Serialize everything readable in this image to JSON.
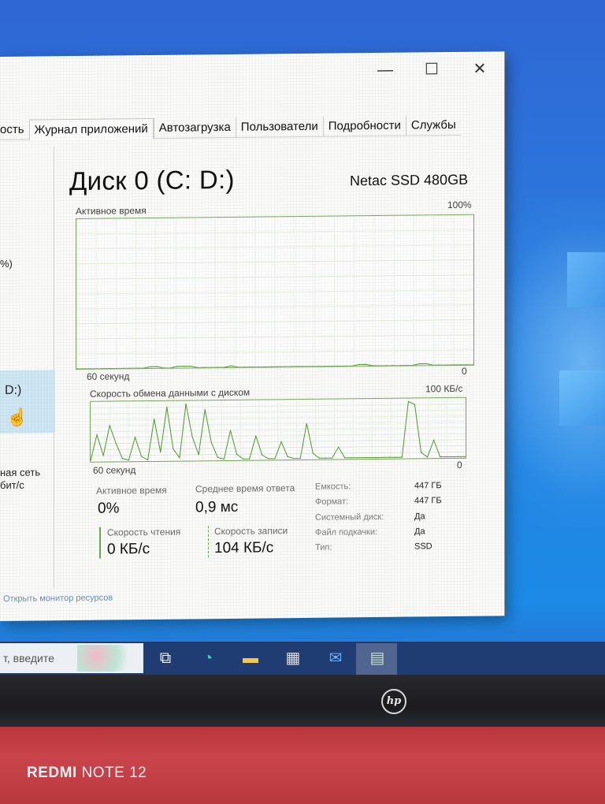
{
  "window": {
    "minimize_glyph": "—",
    "maximize_glyph": "☐",
    "close_glyph": "✕"
  },
  "tabs": [
    "ость",
    "Журнал приложений",
    "Автозагрузка",
    "Пользователи",
    "Подробности",
    "Службы"
  ],
  "sidebar": {
    "item_pct": "%)",
    "item_disk": "D:)",
    "item_net_1": "ная сеть",
    "item_net_2": "бит/с"
  },
  "disk": {
    "title": "Диск 0 (C: D:)",
    "model": "Netac SSD 480GB"
  },
  "graph_active": {
    "label": "Активное время",
    "max_label": "100%",
    "time_label": "60 секунд",
    "min_label": "0"
  },
  "graph_transfer": {
    "label": "Скорость обмена данными с диском",
    "max_label": "100 КБ/с",
    "time_label": "60 секунд",
    "min_label": "0"
  },
  "chart_data": [
    {
      "type": "area",
      "title": "Активное время",
      "xlabel": "60 секунд",
      "ylim": [
        0,
        100
      ],
      "series": [
        {
          "values": [
            0,
            0,
            0,
            0,
            0,
            0,
            0,
            0,
            0,
            0,
            0,
            1,
            1,
            0,
            0,
            1,
            1,
            1,
            0,
            0,
            0,
            0,
            0,
            1,
            0,
            0,
            0,
            0,
            0,
            0,
            0,
            0,
            0,
            0,
            0,
            0,
            0,
            0,
            0,
            0,
            0,
            0,
            1,
            1,
            0,
            0,
            0,
            0,
            0,
            0,
            0,
            1,
            1,
            0,
            0,
            0,
            0,
            0,
            0,
            0
          ]
        }
      ]
    },
    {
      "type": "line",
      "title": "Скорость обмена данными с диском",
      "xlabel": "60 секунд",
      "ylim": [
        0,
        100
      ],
      "series": [
        {
          "values": [
            2,
            45,
            10,
            60,
            30,
            5,
            2,
            40,
            8,
            2,
            70,
            15,
            90,
            20,
            5,
            95,
            40,
            10,
            85,
            30,
            5,
            2,
            50,
            10,
            2,
            2,
            40,
            8,
            2,
            2,
            30,
            5,
            2,
            2,
            60,
            10,
            2,
            2,
            2,
            20,
            2,
            2,
            2,
            2,
            2,
            2,
            2,
            2,
            2,
            2,
            95,
            90,
            10,
            2,
            30,
            2,
            2,
            2,
            2,
            2
          ]
        }
      ]
    }
  ],
  "stats": {
    "active_label": "Активное время",
    "active_value": "0%",
    "resp_label": "Среднее время ответа",
    "resp_value": "0,9 мс",
    "read_label": "Скорость чтения",
    "read_value": "0 КБ/с",
    "write_label": "Скорость записи",
    "write_value": "104 КБ/с"
  },
  "props": [
    {
      "key": "Емкость:",
      "value": "447 ГБ"
    },
    {
      "key": "Формат:",
      "value": "447 ГБ"
    },
    {
      "key": "Системный диск:",
      "value": "Да"
    },
    {
      "key": "Файл подкачки:",
      "value": "Да"
    },
    {
      "key": "Тип:",
      "value": "SSD"
    }
  ],
  "footer_link": "Открыть монитор ресурсов",
  "taskbar": {
    "search_text": "т, введите",
    "icons": [
      "task-view-icon",
      "edge-icon",
      "file-explorer-icon",
      "store-icon",
      "mail-icon",
      "task-manager-icon"
    ]
  },
  "device": {
    "brand_logo": "hp",
    "phone_brand": "REDMI",
    "phone_model": "NOTE 12"
  }
}
